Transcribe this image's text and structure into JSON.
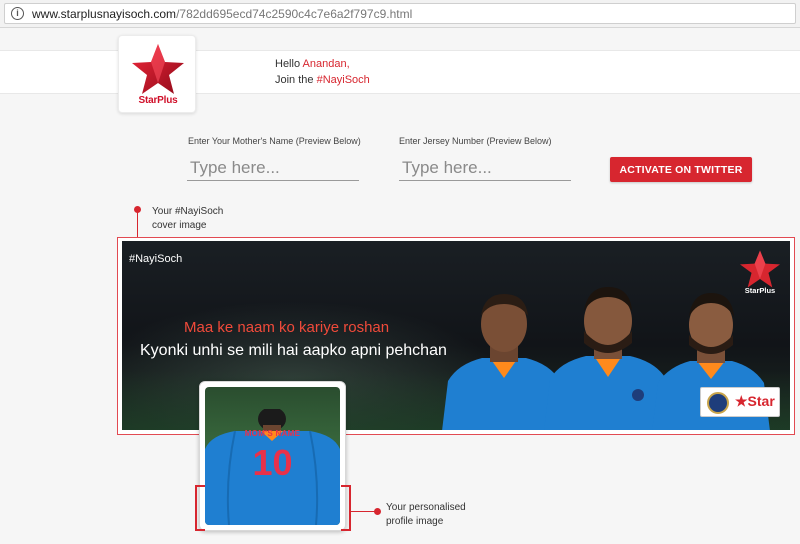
{
  "browser": {
    "url_host": "www.starplusnayisoch.com",
    "url_path": "/782dd695ecd74c2590c4c7e6a2f797c9.html"
  },
  "header": {
    "logo_text": "StarPlus",
    "greeting_prefix": "Hello ",
    "user_name": "Anandan,",
    "join_prefix": "Join the ",
    "hashtag": "#NayiSoch"
  },
  "form": {
    "mother_label": "Enter Your Mother's Name (Preview Below)",
    "mother_placeholder": "Type here...",
    "jersey_label": "Enter Jersey Number (Preview Below)",
    "jersey_placeholder": "Type here...",
    "activate_label": "ACTIVATE ON TWITTER"
  },
  "cover_callout": {
    "line1": "Your #NayiSoch",
    "line2": "cover image"
  },
  "cover": {
    "hashtag": "#NayiSoch",
    "line1": "Maa ke naam ko kariye roshan",
    "line2": "Kyonki unhi se mili hai aapko apni pehchan",
    "logo_text": "StarPlus",
    "sponsor_text": "★Star"
  },
  "profile": {
    "moms_name": "MOM'S NAME",
    "jersey_number": "10"
  },
  "profile_callout": {
    "line1": "Your personalised",
    "line2": "profile image"
  },
  "colors": {
    "accent": "#d7262f",
    "jersey_blue": "#1f7fd1"
  }
}
